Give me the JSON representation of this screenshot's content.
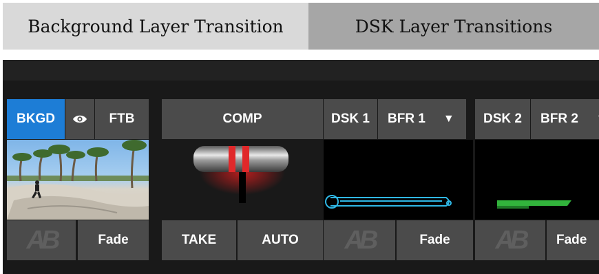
{
  "tabs": {
    "background": "Background Layer Transition",
    "dsk": "DSK Layer Transitions"
  },
  "controls": {
    "bkgd": "BKGD",
    "ftb": "FTB",
    "comp": "COMP",
    "dsk1": "DSK 1",
    "bfr1": "BFR 1",
    "dsk2": "DSK 2",
    "bfr2": "BFR 2",
    "take": "TAKE",
    "auto": "AUTO",
    "fade": "Fade",
    "ab_logo": "AB"
  },
  "icons": {
    "eye": "eye-icon",
    "caret": "caret-down-icon",
    "ab": "ab-transition-icon"
  },
  "colors": {
    "active_blue": "#1d7dd6",
    "button_gray": "#4b4b4b",
    "tbar_red": "#e0282a",
    "overlay_cyan": "#2fb8e6",
    "overlay_green": "#32b43c"
  }
}
